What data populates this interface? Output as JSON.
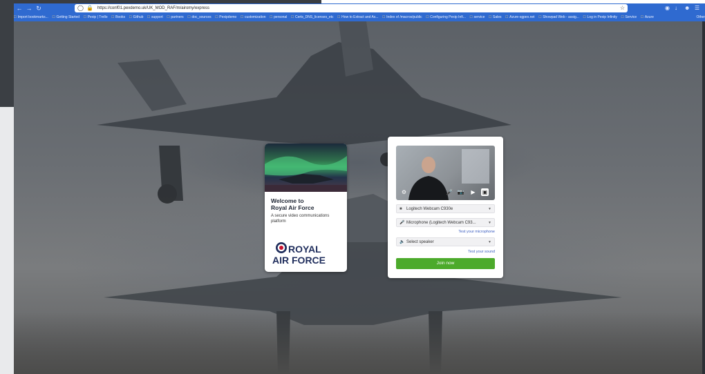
{
  "browser": {
    "url": "https://conf01.pexdemo.uk/UK_MOD_RAF/m/airomy/express",
    "bookmarks": [
      {
        "label": "Import bookmarks..."
      },
      {
        "label": "Getting Started"
      },
      {
        "label": "Pexip | Trello"
      },
      {
        "label": "Books"
      },
      {
        "label": "Github"
      },
      {
        "label": "support"
      },
      {
        "label": "partners"
      },
      {
        "label": "doc_sources"
      },
      {
        "label": "Pexipdemo"
      },
      {
        "label": "customization"
      },
      {
        "label": "personal"
      },
      {
        "label": "Certs_DNS_licenses_etc"
      },
      {
        "label": "How to Extract and As..."
      },
      {
        "label": "Index of /macros/public"
      },
      {
        "label": "Configuring Pexip Infi..."
      },
      {
        "label": "service"
      },
      {
        "label": "Sales"
      },
      {
        "label": "Azure-sgpex.net"
      },
      {
        "label": "Showpad Web - assig..."
      },
      {
        "label": "Log in Pexip Infinity"
      },
      {
        "label": "Service"
      },
      {
        "label": "Azure"
      }
    ],
    "other_bookmarks": "Other"
  },
  "welcome": {
    "title_line1": "Welcome to",
    "title_line2": "Royal Air Force",
    "subtitle": "A secure video communications platform",
    "logo_text_1": "ROYAL",
    "logo_text_2": "AIR FORCE"
  },
  "join": {
    "camera": "Logitech Webcam C930e",
    "microphone": "Microphone (Logitech Webcam C93...",
    "test_microphone": "Test your microphone",
    "speaker_placeholder": "Select speaker",
    "test_sound": "Test your sound",
    "join_button": "Join now"
  },
  "colors": {
    "browser_chrome": "#2f6ad0",
    "join_button": "#4caa2b",
    "link": "#3a5dbf",
    "raf_navy": "#1f2d5c"
  }
}
